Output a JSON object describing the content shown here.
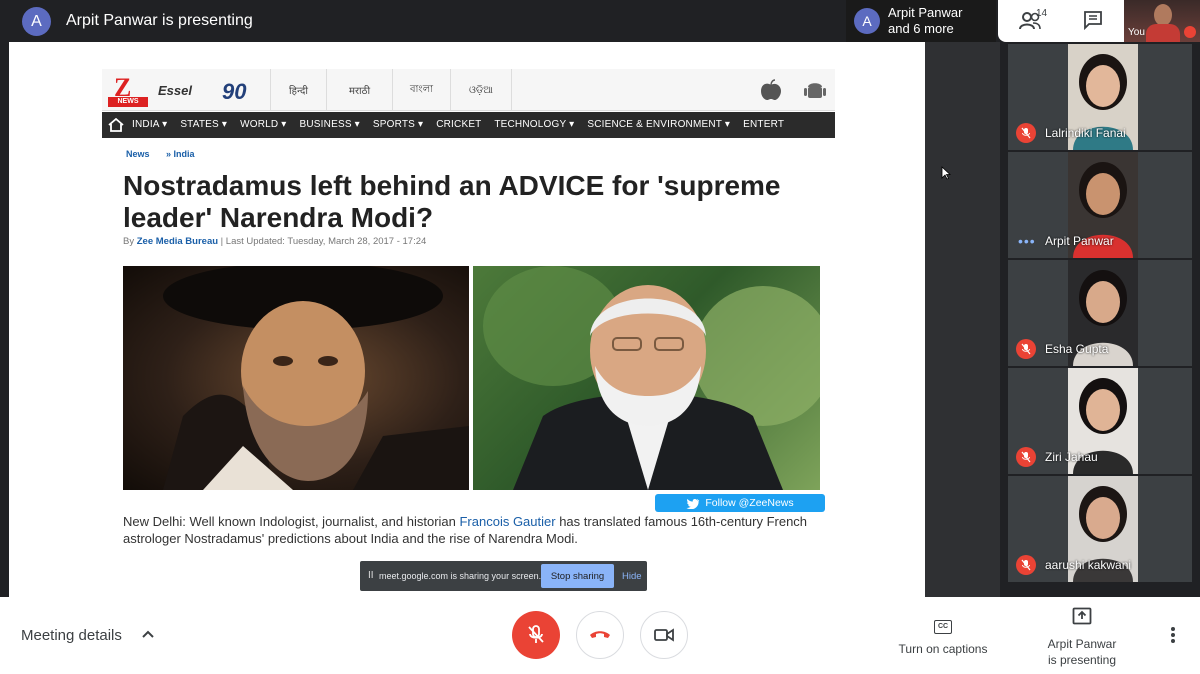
{
  "topbar": {
    "presenter_initial": "A",
    "presenting_title": "Arpit Panwar is presenting",
    "participants_chip_initial": "A",
    "participants_chip_line1": "Arpit Panwar",
    "participants_chip_line2": "and 6 more",
    "people_count": "14",
    "self_label": "You"
  },
  "shared_page": {
    "logo_z": "Z",
    "logo_news": "NEWS",
    "essel": "Essel",
    "ninety": "90",
    "languages": [
      "हिन्दी",
      "मराठी",
      "বাংলা",
      "ଓଡ଼ିଆ"
    ],
    "nav": [
      "INDIA ▾",
      "STATES ▾",
      "WORLD ▾",
      "BUSINESS ▾",
      "SPORTS ▾",
      "CRICKET",
      "TECHNOLOGY ▾",
      "SCIENCE & ENVIRONMENT ▾",
      "ENTERT"
    ],
    "breadcrumb": [
      "News",
      "» India"
    ],
    "headline": "Nostradamus left behind an ADVICE for 'supreme leader' Narendra Modi?",
    "byline_prefix": "By ",
    "byline_author": "Zee Media Bureau",
    "byline_rest": " | Last Updated: Tuesday, March 28, 2017 - 17:24",
    "follow_label": "Follow @ZeeNews",
    "article_part1": "New Delhi: Well known Indologist, journalist, and historian ",
    "article_link": "Francois Gautier",
    "article_part2": " has translated famous 16th-century French astrologer Nostradamus' predictions about India and the rise of Narendra Modi."
  },
  "share_bar": {
    "pause": "II",
    "message": "meet.google.com is sharing your screen.",
    "stop_label": "Stop sharing",
    "hide_label": "Hide"
  },
  "participants": [
    {
      "name": "Lalrindiki Fanai",
      "muted": true,
      "bg": "#d8d2c8",
      "shirt": "#2f7a86",
      "skin": "#e2b79a",
      "hair": "#1a1412"
    },
    {
      "name": "Arpit Panwar",
      "muted": false,
      "bg": "#3a3533",
      "shirt": "#d9312f",
      "skin": "#c9936f",
      "hair": "#1a1412"
    },
    {
      "name": "Esha Gupta",
      "muted": true,
      "bg": "#2a2a2c",
      "shirt": "#d9d4ce",
      "skin": "#d8a98a",
      "hair": "#141010"
    },
    {
      "name": "Ziri Jahau",
      "muted": true,
      "bg": "#e6e3df",
      "shirt": "#2a2a2a",
      "skin": "#e0b496",
      "hair": "#141010"
    },
    {
      "name": "aarushi kakwani",
      "muted": true,
      "bg": "#d6d3cf",
      "shirt": "#3a3838",
      "skin": "#d9aa8e",
      "hair": "#1c1614"
    }
  ],
  "bottombar": {
    "meeting_details": "Meeting details",
    "captions_icon": "CC",
    "captions_label": "Turn on captions",
    "present_line1": "Arpit Panwar",
    "present_line2": "is presenting"
  },
  "colors": {
    "accent_red": "#ea4335",
    "accent_blue": "#8ab4f8",
    "twitter_blue": "#1da1f2",
    "link_blue": "#1a5fa8"
  }
}
